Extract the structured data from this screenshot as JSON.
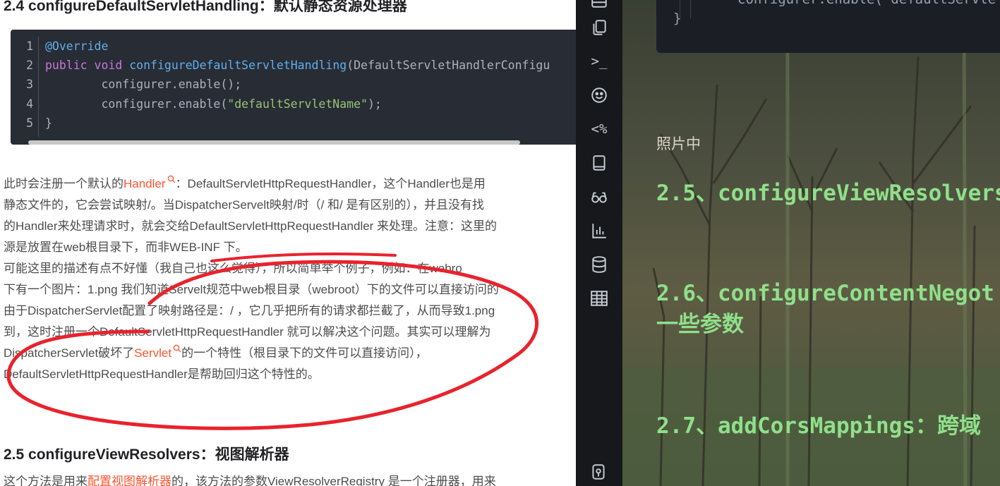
{
  "article": {
    "heading_24": "2.4 configureDefaultServletHandling：默认静态资源处理器",
    "code_lines": [
      {
        "n": "1"
      },
      {
        "n": "2"
      },
      {
        "n": "3"
      },
      {
        "n": "4"
      },
      {
        "n": "5"
      }
    ],
    "code": {
      "l1_anno": "@Override",
      "l2_kw1": "public",
      "l2_kw2": "void",
      "l2_fn": "configureDefaultServletHandling",
      "l2_rest": "(DefaultServletHandlerConfigu",
      "l3": "        configurer.enable();",
      "l4_pre": "        configurer.enable(",
      "l4_str": "\"defaultServletName\"",
      "l4_post": ");",
      "l5": "}"
    },
    "p1_pre": "此时会注册一个默认的",
    "p1_link": "Handler",
    "p1_post": "：DefaultServletHttpRequestHandler，这个Handler也是用",
    "p2": "静态文件的，它会尝试映射/。当DispatcherServelt映射/时（/ 和/ 是有区别的），并且没有找",
    "p3": "的Handler来处理请求时，就会交给DefaultServletHttpRequestHandler 来处理。注意：这里的",
    "p4": "源是放置在web根目录下，而非WEB-INF 下。",
    "p5": "        可能这里的描述有点不好懂（我自己也这么觉得），所以简单举个例子，例如：在webro",
    "p6": "下有一个图片：1.png 我们知道Servelt规范中web根目录（webroot）下的文件可以直接访问的",
    "p7": "由于DispatcherServlet配置了映射路径是：/ ，它几乎把所有的请求都拦截了，从而导致1.png",
    "p8": "到，这时注册一个DefaultServletHttpRequestHandler 就可以解决这个问题。其实可以理解为",
    "p9_pre": "DispatcherServlet破坏了",
    "p9_link": "Servlet",
    "p9_post": "的一个特性（根目录下的文件可以直接访问），",
    "p10": "DefaultServletHttpRequestHandler是帮助回归这个特性的。",
    "heading_25": "2.5 configureViewResolvers：视图解析器",
    "p11_pre": "这个方法是用来",
    "p11_link": "配置视图解析器",
    "p11_post": "的，该方法的参数ViewResolverRegistry 是一个注册器，用来"
  },
  "editor": {
    "code_top": "configurer.enable(\"defaultServle",
    "code_brace": "}",
    "photo_label": "照片中",
    "head_25": "2.5、configureViewResolvers",
    "head_26a": "2.6、configureContentNegot",
    "head_26b": "一些参数",
    "head_27": "2.7、addCorsMappings：跨域",
    "activity_icons": [
      "panel-icon",
      "files-icon",
      "terminal-icon",
      "emoji-icon",
      "percent-icon",
      "book-icon",
      "glasses-icon",
      "chart-icon",
      "database-icon",
      "table-icon",
      "scroll-icon"
    ],
    "percent_label": "<%",
    "terminal_label": ">_"
  },
  "colors": {
    "link": "#fc5531",
    "code_bg": "#282c34",
    "annotation_circle": "#e8232d",
    "md_heading": "#8fe08a"
  }
}
